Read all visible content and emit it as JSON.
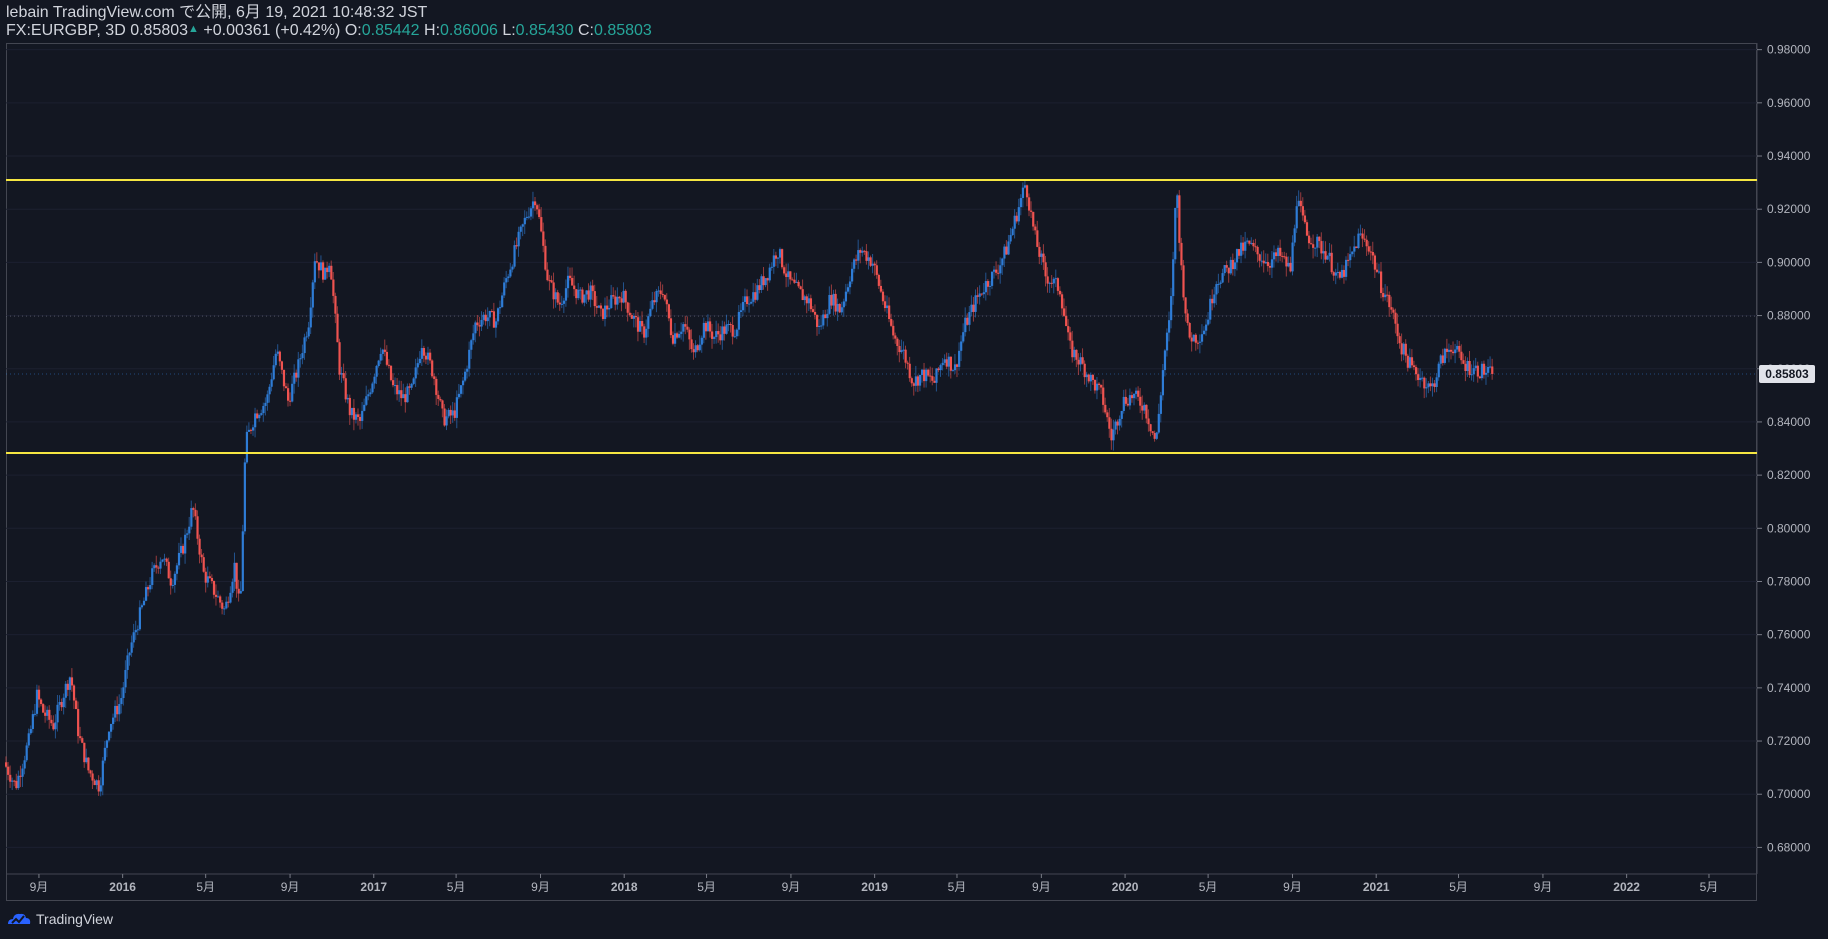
{
  "header": {
    "published": "lebain TradingView.com で公開, 6月 19, 2021 10:48:32 JST",
    "symbol": "FX:EURGBP, 3D",
    "last": "0.85803",
    "change": "+0.00361 (+0.42%)",
    "o_label": "O:",
    "o_value": "0.85442",
    "h_label": "H:",
    "h_value": "0.86006",
    "l_label": "L:",
    "l_value": "0.85430",
    "c_label": "C:",
    "c_value": "0.85803"
  },
  "footer": {
    "brand": "TradingView"
  },
  "colors": {
    "background": "#131722",
    "up": "#2e7cd6",
    "down": "#ef5350",
    "level": "#f5e642",
    "price_tag": "#e1e3ea"
  },
  "chart_data": {
    "type": "candlestick",
    "symbol": "FX:EURGBP",
    "timeframe": "3D",
    "ylim": [
      0.67,
      0.9825
    ],
    "y_ticks": [
      "0.68000",
      "0.70000",
      "0.72000",
      "0.74000",
      "0.76000",
      "0.78000",
      "0.80000",
      "0.82000",
      "0.84000",
      "0.86000",
      "0.88000",
      "0.90000",
      "0.92000",
      "0.94000",
      "0.96000",
      "0.98000"
    ],
    "x_ticks": [
      "9月",
      "2016",
      "5月",
      "9月",
      "2017",
      "5月",
      "9月",
      "2018",
      "5月",
      "9月",
      "2019",
      "5月",
      "9月",
      "2020",
      "5月",
      "9月",
      "2021",
      "5月",
      "9月",
      "2022",
      "5月"
    ],
    "x_range": [
      "2015-07-15",
      "2022-07-10"
    ],
    "last_price": "0.85803",
    "horizontal_levels": [
      0.931,
      0.8283
    ],
    "reference_level": 0.8798,
    "price_path": [
      [
        "2015-07-15",
        0.712
      ],
      [
        "2015-08-01",
        0.703
      ],
      [
        "2015-08-20",
        0.72
      ],
      [
        "2015-09-01",
        0.737
      ],
      [
        "2015-09-10",
        0.731
      ],
      [
        "2015-09-25",
        0.726
      ],
      [
        "2015-10-10",
        0.738
      ],
      [
        "2015-10-20",
        0.745
      ],
      [
        "2015-11-01",
        0.722
      ],
      [
        "2015-11-15",
        0.709
      ],
      [
        "2015-12-01",
        0.703
      ],
      [
        "2015-12-15",
        0.726
      ],
      [
        "2016-01-01",
        0.735
      ],
      [
        "2016-01-15",
        0.755
      ],
      [
        "2016-02-01",
        0.77
      ],
      [
        "2016-02-15",
        0.782
      ],
      [
        "2016-03-01",
        0.79
      ],
      [
        "2016-03-15",
        0.78
      ],
      [
        "2016-04-01",
        0.793
      ],
      [
        "2016-04-15",
        0.808
      ],
      [
        "2016-05-01",
        0.783
      ],
      [
        "2016-05-15",
        0.777
      ],
      [
        "2016-06-01",
        0.769
      ],
      [
        "2016-06-15",
        0.786
      ],
      [
        "2016-06-23",
        0.768
      ],
      [
        "2016-07-01",
        0.832
      ],
      [
        "2016-07-15",
        0.843
      ],
      [
        "2016-08-01",
        0.848
      ],
      [
        "2016-08-15",
        0.867
      ],
      [
        "2016-09-01",
        0.848
      ],
      [
        "2016-09-15",
        0.86
      ],
      [
        "2016-10-01",
        0.878
      ],
      [
        "2016-10-10",
        0.902
      ],
      [
        "2016-10-25",
        0.895
      ],
      [
        "2016-11-01",
        0.902
      ],
      [
        "2016-11-15",
        0.86
      ],
      [
        "2016-12-01",
        0.843
      ],
      [
        "2016-12-15",
        0.84
      ],
      [
        "2017-01-01",
        0.855
      ],
      [
        "2017-01-15",
        0.869
      ],
      [
        "2017-02-01",
        0.853
      ],
      [
        "2017-02-15",
        0.849
      ],
      [
        "2017-03-01",
        0.852
      ],
      [
        "2017-03-15",
        0.87
      ],
      [
        "2017-04-01",
        0.858
      ],
      [
        "2017-04-15",
        0.841
      ],
      [
        "2017-05-01",
        0.843
      ],
      [
        "2017-05-15",
        0.856
      ],
      [
        "2017-06-01",
        0.877
      ],
      [
        "2017-06-15",
        0.88
      ],
      [
        "2017-07-01",
        0.878
      ],
      [
        "2017-07-15",
        0.893
      ],
      [
        "2017-08-01",
        0.907
      ],
      [
        "2017-08-15",
        0.918
      ],
      [
        "2017-08-28",
        0.925
      ],
      [
        "2017-09-15",
        0.893
      ],
      [
        "2017-10-01",
        0.884
      ],
      [
        "2017-10-15",
        0.893
      ],
      [
        "2017-11-01",
        0.887
      ],
      [
        "2017-11-15",
        0.889
      ],
      [
        "2017-12-01",
        0.88
      ],
      [
        "2017-12-15",
        0.885
      ],
      [
        "2018-01-01",
        0.888
      ],
      [
        "2018-01-15",
        0.88
      ],
      [
        "2018-02-01",
        0.873
      ],
      [
        "2018-02-15",
        0.885
      ],
      [
        "2018-03-01",
        0.89
      ],
      [
        "2018-03-15",
        0.872
      ],
      [
        "2018-04-01",
        0.877
      ],
      [
        "2018-04-15",
        0.865
      ],
      [
        "2018-05-01",
        0.877
      ],
      [
        "2018-05-15",
        0.872
      ],
      [
        "2018-06-01",
        0.875
      ],
      [
        "2018-06-15",
        0.875
      ],
      [
        "2018-07-01",
        0.886
      ],
      [
        "2018-07-15",
        0.889
      ],
      [
        "2018-08-01",
        0.896
      ],
      [
        "2018-08-15",
        0.905
      ],
      [
        "2018-09-01",
        0.893
      ],
      [
        "2018-09-15",
        0.889
      ],
      [
        "2018-10-01",
        0.885
      ],
      [
        "2018-10-15",
        0.875
      ],
      [
        "2018-11-01",
        0.887
      ],
      [
        "2018-11-15",
        0.882
      ],
      [
        "2018-12-01",
        0.897
      ],
      [
        "2018-12-15",
        0.905
      ],
      [
        "2019-01-01",
        0.9
      ],
      [
        "2019-01-15",
        0.887
      ],
      [
        "2019-02-01",
        0.872
      ],
      [
        "2019-02-15",
        0.866
      ],
      [
        "2019-03-01",
        0.855
      ],
      [
        "2019-03-15",
        0.858
      ],
      [
        "2019-04-01",
        0.855
      ],
      [
        "2019-04-15",
        0.865
      ],
      [
        "2019-05-01",
        0.86
      ],
      [
        "2019-05-15",
        0.876
      ],
      [
        "2019-06-01",
        0.886
      ],
      [
        "2019-06-15",
        0.892
      ],
      [
        "2019-07-01",
        0.897
      ],
      [
        "2019-07-15",
        0.905
      ],
      [
        "2019-08-01",
        0.92
      ],
      [
        "2019-08-12",
        0.93
      ],
      [
        "2019-08-25",
        0.91
      ],
      [
        "2019-09-10",
        0.895
      ],
      [
        "2019-10-01",
        0.89
      ],
      [
        "2019-10-15",
        0.868
      ],
      [
        "2019-11-01",
        0.862
      ],
      [
        "2019-11-15",
        0.856
      ],
      [
        "2019-12-01",
        0.85
      ],
      [
        "2019-12-15",
        0.834
      ],
      [
        "2020-01-01",
        0.848
      ],
      [
        "2020-01-15",
        0.85
      ],
      [
        "2020-02-01",
        0.846
      ],
      [
        "2020-02-18",
        0.832
      ],
      [
        "2020-03-01",
        0.865
      ],
      [
        "2020-03-10",
        0.88
      ],
      [
        "2020-03-19",
        0.93
      ],
      [
        "2020-03-25",
        0.9
      ],
      [
        "2020-04-05",
        0.872
      ],
      [
        "2020-04-20",
        0.872
      ],
      [
        "2020-05-01",
        0.877
      ],
      [
        "2020-05-15",
        0.893
      ],
      [
        "2020-06-01",
        0.897
      ],
      [
        "2020-06-15",
        0.903
      ],
      [
        "2020-07-01",
        0.907
      ],
      [
        "2020-07-15",
        0.903
      ],
      [
        "2020-08-01",
        0.9
      ],
      [
        "2020-08-15",
        0.903
      ],
      [
        "2020-09-01",
        0.897
      ],
      [
        "2020-09-10",
        0.924
      ],
      [
        "2020-09-25",
        0.91
      ],
      [
        "2020-10-10",
        0.907
      ],
      [
        "2020-10-25",
        0.903
      ],
      [
        "2020-11-10",
        0.893
      ],
      [
        "2020-11-25",
        0.9
      ],
      [
        "2020-12-10",
        0.91
      ],
      [
        "2020-12-25",
        0.906
      ],
      [
        "2021-01-10",
        0.892
      ],
      [
        "2021-01-25",
        0.883
      ],
      [
        "2021-02-10",
        0.868
      ],
      [
        "2021-02-25",
        0.86
      ],
      [
        "2021-03-10",
        0.857
      ],
      [
        "2021-03-25",
        0.852
      ],
      [
        "2021-04-10",
        0.864
      ],
      [
        "2021-04-25",
        0.869
      ],
      [
        "2021-05-10",
        0.862
      ],
      [
        "2021-05-25",
        0.86
      ],
      [
        "2021-06-10",
        0.859
      ],
      [
        "2021-06-19",
        0.858
      ]
    ]
  }
}
